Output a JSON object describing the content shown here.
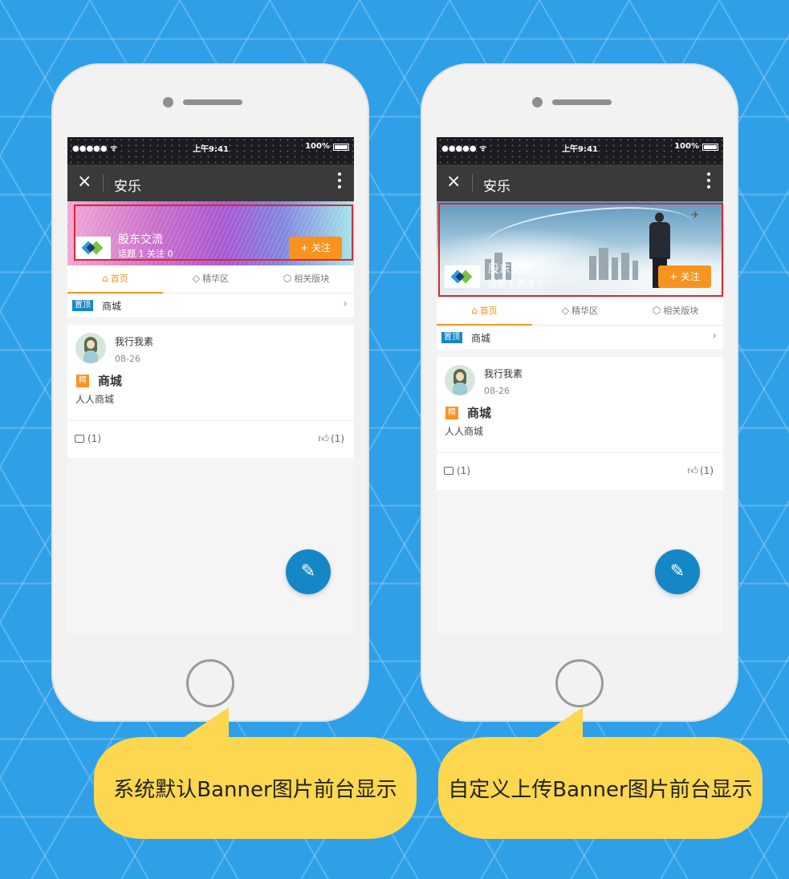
{
  "status_bar": {
    "signal": "●●●●● ᯤ",
    "time": "上午9:41",
    "battery": "100%"
  },
  "nav": {
    "close_icon": "×",
    "title": "安乐",
    "more_icon": "⋮"
  },
  "banner": {
    "name": "股东交流",
    "stats": "话题 1 关注 0",
    "follow_label": "+ 关注"
  },
  "tabs": [
    {
      "label": "首页",
      "icon": "⌂"
    },
    {
      "label": "精华区",
      "icon": "◇"
    },
    {
      "label": "相关版块",
      "icon": "⬡"
    }
  ],
  "pinned": {
    "badge": "置顶",
    "text": "商城",
    "arrow": "›"
  },
  "post": {
    "author": "我行我素",
    "date": "08-26",
    "badge": "精",
    "title": "商城",
    "desc": "人人商城",
    "comments": "(1)",
    "likes": "(1)"
  },
  "fab_icon": "✎",
  "captions": {
    "left": "系统默认Banner图片前台显示",
    "right": "自定义上传Banner图片前台显示"
  },
  "colors": {
    "accent": "#f7931e",
    "brand": "#1587c6",
    "highlight": "#e0262b",
    "callout": "#fcd74f"
  }
}
